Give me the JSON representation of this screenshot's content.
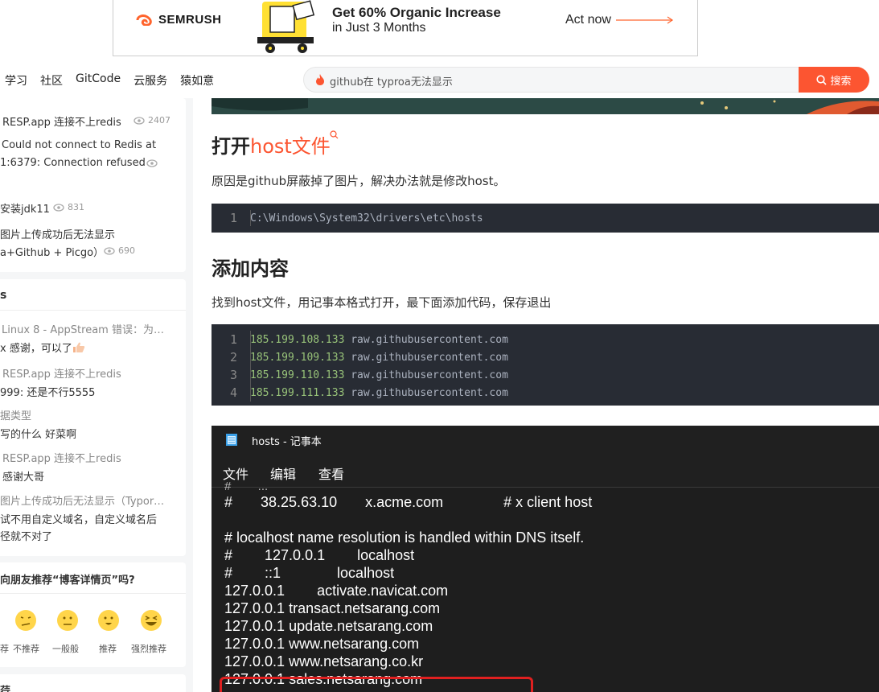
{
  "ad": {
    "brand": "SEMRUSH",
    "headline": "Get 60% Organic Increase",
    "subline": "in Just 3 Months",
    "cta": "Act now"
  },
  "nav": {
    "links": [
      "学习",
      "社区",
      "GitCode",
      "云服务",
      "猿如意"
    ],
    "search_query": "github在 typroa无法显示",
    "search_button": "搜索"
  },
  "sidebar": {
    "related": [
      {
        "title": "RESP.app 连接不上redis",
        "views": "2407"
      },
      {
        "title_line1": "Could not connect to Redis at",
        "title_line2": "1:6379: Connection refused"
      },
      {
        "title": "安装jdk11",
        "views": "831"
      },
      {
        "title_line1": "图片上传成功后无法显示",
        "title_line2": "a+Github + Picgo）",
        "views": "690"
      }
    ],
    "comments_header": "s",
    "comments": [
      {
        "title": "Linux 8 - AppStream 错误：为…",
        "text": "x 感谢，可以了"
      },
      {
        "title": "RESP.app 连接不上redis",
        "text": "999: 还是不行5555"
      },
      {
        "title": "据类型",
        "text": "写的什么 好菜啊"
      },
      {
        "title": "RESP.app 连接不上redis",
        "text": "感谢大哥"
      },
      {
        "title": "图片上传成功后无法显示（Typor…",
        "text_line1": "试不用自定义域名，自定义域名后",
        "text_line2": "径就不对了"
      }
    ],
    "rating_question": "向朋友推荐“博客详情页”吗?",
    "ratings": [
      "荐",
      "不推荐",
      "一般般",
      "推荐",
      "强烈推荐"
    ],
    "bottom_label": "荇"
  },
  "article": {
    "heading_open_prefix": "打开",
    "heading_open_keyword": "host文件",
    "para1": "原因是github屏蔽掉了图片，解决办法就是修改host。",
    "code1": [
      {
        "n": "1",
        "text": "C:\\Windows\\System32\\drivers\\etc\\hosts"
      }
    ],
    "heading_add": "添加内容",
    "para2": "找到host文件，用记事本格式打开，最下面添加代码，保存退出",
    "code2": [
      {
        "n": "1",
        "ip": "185.199.108.133",
        "host": "raw.githubusercontent.com"
      },
      {
        "n": "2",
        "ip": "185.199.109.133",
        "host": "raw.githubusercontent.com"
      },
      {
        "n": "3",
        "ip": "185.199.110.133",
        "host": "raw.githubusercontent.com"
      },
      {
        "n": "4",
        "ip": "185.199.111.133",
        "host": "raw.githubusercontent.com"
      }
    ]
  },
  "notepad": {
    "title": "hosts - 记事本",
    "menu": [
      "文件",
      "编辑",
      "查看"
    ],
    "lines": [
      "#       38.25.63.10       x.acme.com               # x client host",
      "# localhost name resolution is handled within DNS itself.",
      "#        127.0.0.1        localhost",
      "#        ::1              localhost",
      "127.0.0.1        activate.navicat.com",
      "127.0.0.1 transact.netsarang.com",
      "127.0.0.1 update.netsarang.com",
      "127.0.0.1 www.netsarang.com",
      "127.0.0.1 www.netsarang.co.kr",
      "127.0.0.1 sales.netsarang.com"
    ]
  }
}
